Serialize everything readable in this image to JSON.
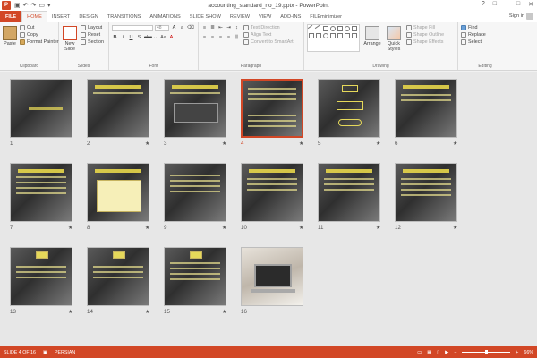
{
  "window": {
    "title": "accounting_standard_no_19.pptx - PowerPoint",
    "app_icon": "P",
    "controls": [
      "?",
      "□",
      "–",
      "□",
      "✕"
    ]
  },
  "ribbon_tabs": {
    "file": "FILE",
    "items": [
      "HOME",
      "INSERT",
      "DESIGN",
      "TRANSITIONS",
      "ANIMATIONS",
      "SLIDE SHOW",
      "REVIEW",
      "VIEW",
      "ADD-INS",
      "FILEminimizer"
    ],
    "active": "HOME",
    "sign_in": "Sign in"
  },
  "ribbon": {
    "clipboard": {
      "paste": "Paste",
      "cut": "Cut",
      "copy": "Copy",
      "format_painter": "Format Painter",
      "label": "Clipboard"
    },
    "slides": {
      "new_slide": "New Slide",
      "layout": "Layout",
      "reset": "Reset",
      "section": "Section",
      "label": "Slides"
    },
    "font": {
      "size": "48",
      "label": "Font"
    },
    "paragraph": {
      "text_direction": "Text Direction",
      "align_text": "Align Text",
      "convert": "Convert to SmartArt",
      "label": "Paragraph"
    },
    "drawing": {
      "arrange": "Arrange",
      "quick_styles": "Quick Styles",
      "shape_fill": "Shape Fill",
      "shape_outline": "Shape Outline",
      "shape_effects": "Shape Effects",
      "label": "Drawing"
    },
    "editing": {
      "find": "Find",
      "replace": "Replace",
      "select": "Select",
      "label": "Editing"
    }
  },
  "slides": [
    {
      "number": "1",
      "star": ""
    },
    {
      "number": "2",
      "star": "★"
    },
    {
      "number": "3",
      "star": "★"
    },
    {
      "number": "4",
      "star": "★"
    },
    {
      "number": "5",
      "star": "★"
    },
    {
      "number": "6",
      "star": "★"
    },
    {
      "number": "7",
      "star": "★"
    },
    {
      "number": "8",
      "star": "★"
    },
    {
      "number": "9",
      "star": "★"
    },
    {
      "number": "10",
      "star": "★"
    },
    {
      "number": "11",
      "star": "★"
    },
    {
      "number": "12",
      "star": "★"
    },
    {
      "number": "13",
      "star": "★"
    },
    {
      "number": "14",
      "star": "★"
    },
    {
      "number": "15",
      "star": "★"
    },
    {
      "number": "16",
      "star": ""
    }
  ],
  "selected_slide": "4",
  "status_bar": {
    "slide_info": "SLIDE 4 OF 16",
    "language": "PERSIAN",
    "zoom": "66%"
  },
  "colors": {
    "accent": "#d24726",
    "ribbon_bg": "#f6f6f6",
    "workspace_bg": "#e7e7e7"
  }
}
